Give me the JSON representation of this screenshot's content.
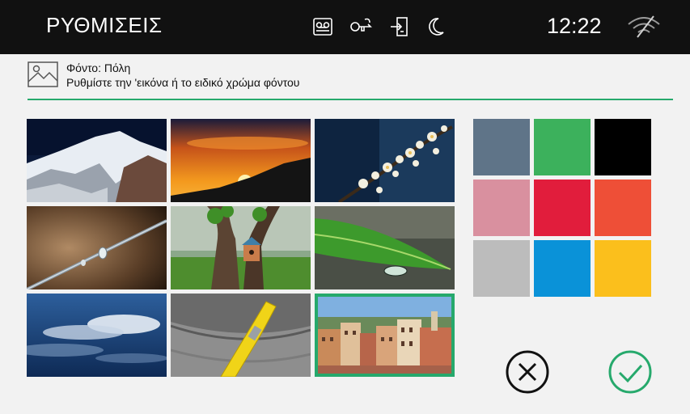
{
  "topbar": {
    "title": "ΡΥΘΜΙΣΕΙΣ",
    "clock": "12:22",
    "status_icons": [
      "voicemail-icon",
      "key-icon",
      "door-entry-icon",
      "moon-icon"
    ],
    "wifi_icon": "wifi-off-icon"
  },
  "header": {
    "icon": "image-icon",
    "title": "Φόντο: Πόλη",
    "subtitle": "Ρυθμίστε την 'εικόνα ή το ειδικό χρώμα φόντου"
  },
  "wallpapers": [
    {
      "subject": "snowy-mountain"
    },
    {
      "subject": "sunset-hills"
    },
    {
      "subject": "blossom-branch"
    },
    {
      "subject": "water-droplet-stem"
    },
    {
      "subject": "birdhouse-tree"
    },
    {
      "subject": "green-leaf-drop"
    },
    {
      "subject": "cloudy-sky"
    },
    {
      "subject": "yellow-clothespin"
    },
    {
      "subject": "city",
      "selected": true
    }
  ],
  "colors": [
    "#5f7488",
    "#3cb15c",
    "#000000",
    "#d9909f",
    "#e11d3c",
    "#ee4f37",
    "#bcbcbc",
    "#0a92d8",
    "#fbbf1c"
  ],
  "accent": "#26a96c",
  "actions": {
    "cancel_icon": "cancel-icon",
    "confirm_icon": "confirm-icon"
  }
}
